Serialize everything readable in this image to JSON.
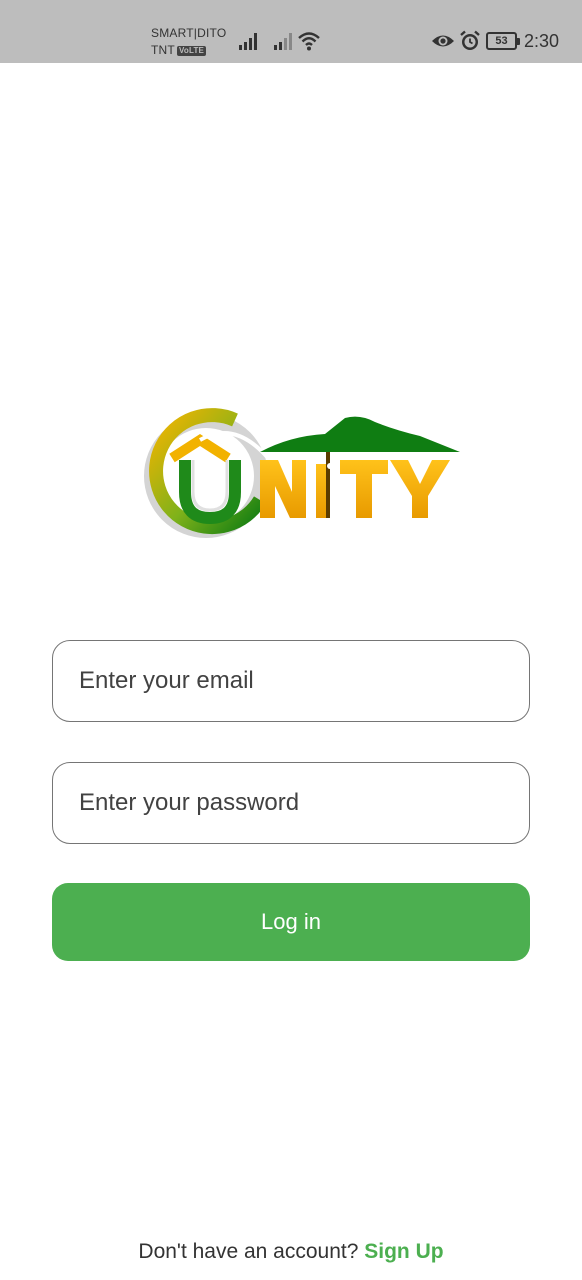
{
  "status_bar": {
    "carrier_line1": "SMART|DITO",
    "carrier_line2": "TNT",
    "volte_badge": "VoLTE",
    "battery_level": "53",
    "time": "2:30",
    "icons": [
      "signal-icon",
      "signal-icon",
      "wifi-icon",
      "eye-icon",
      "alarm-icon",
      "battery-icon"
    ]
  },
  "logo": {
    "text": "UNITY",
    "colors": {
      "gold": "#f5b400",
      "green": "#1f8a1a",
      "dark_green": "#0b6e0b"
    }
  },
  "form": {
    "email_placeholder": "Enter your email",
    "password_placeholder": "Enter your password",
    "login_label": "Log in"
  },
  "signup": {
    "prompt": "Don't have an account?",
    "link_label": "Sign Up"
  },
  "colors": {
    "accent": "#4caf50",
    "status_bar_bg": "#bdbdbd",
    "field_border": "#757575"
  }
}
